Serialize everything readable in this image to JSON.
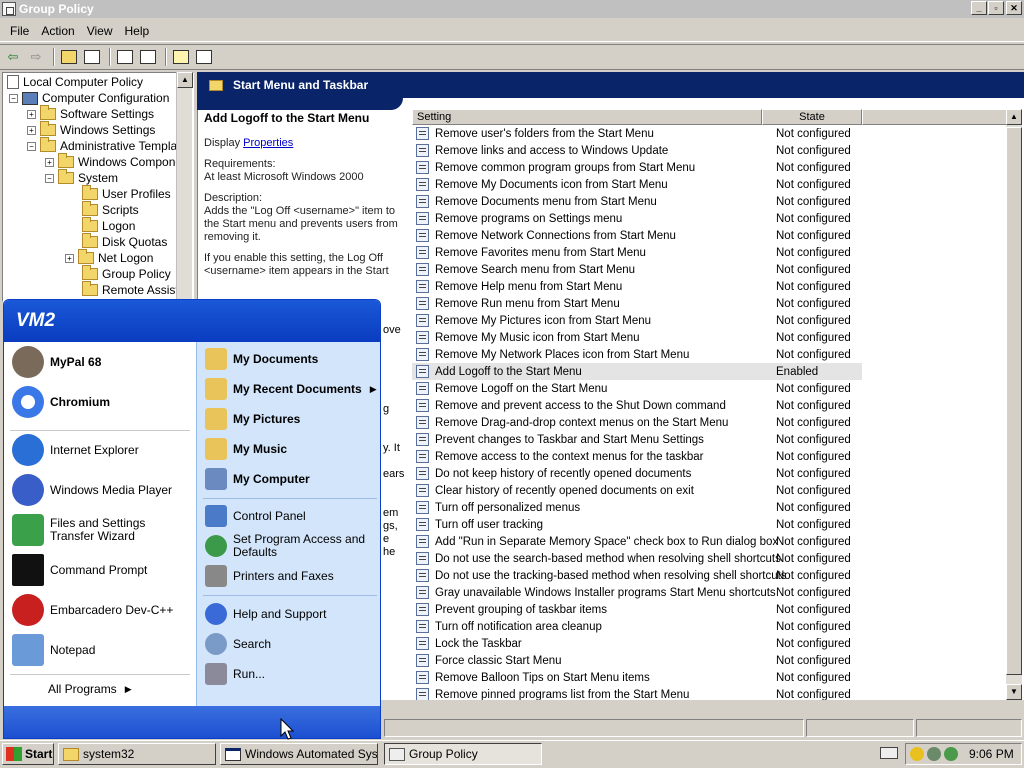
{
  "window": {
    "title": "Group Policy",
    "buttons": [
      "_",
      "▫",
      "✕"
    ]
  },
  "menubar": {
    "items": [
      "File",
      "Action",
      "View",
      "Help"
    ]
  },
  "toolbar": {
    "icons": [
      "back-icon",
      "forward-icon",
      "up-folder-icon",
      "show-hide-tree-icon",
      "properties-icon",
      "export-list-icon",
      "help-icon",
      "console-icon"
    ]
  },
  "tree": {
    "items": [
      {
        "label": "Local Computer Policy",
        "icon": "doc"
      },
      {
        "label": "Computer Configuration",
        "icon": "pc"
      },
      {
        "label": "Software Settings",
        "icon": "folder"
      },
      {
        "label": "Windows Settings",
        "icon": "folder"
      },
      {
        "label": "Administrative Template",
        "icon": "folder"
      },
      {
        "label": "Windows Compone",
        "icon": "folder"
      },
      {
        "label": "System",
        "icon": "folder"
      },
      {
        "label": "User Profiles",
        "icon": "folder"
      },
      {
        "label": "Scripts",
        "icon": "folder"
      },
      {
        "label": "Logon",
        "icon": "folder"
      },
      {
        "label": "Disk Quotas",
        "icon": "folder"
      },
      {
        "label": "Net Logon",
        "icon": "folder"
      },
      {
        "label": "Group Policy",
        "icon": "folder"
      },
      {
        "label": "Remote Assista",
        "icon": "folder"
      }
    ]
  },
  "pane": {
    "header": "Start Menu and Taskbar",
    "desc_title": "Add Logoff to the Start Menu",
    "display_label": "Display",
    "display_link": "Properties",
    "requirements_label": "Requirements:",
    "requirements_value": "At least Microsoft Windows 2000",
    "description_label": "Description:",
    "description_text": "Adds the \"Log Off <username>\" item to the Start menu and prevents users from removing it.",
    "description_more": "If you enable this setting, the Log Off <username> item appears in the Start",
    "peek": [
      "ove",
      "g",
      "y. It",
      "ears",
      "em",
      "gs,",
      "e",
      "he"
    ]
  },
  "list": {
    "columns": [
      "Setting",
      "State"
    ],
    "rows": [
      {
        "setting": "Remove user's folders from the Start Menu",
        "state": "Not configured"
      },
      {
        "setting": "Remove links and access to Windows Update",
        "state": "Not configured"
      },
      {
        "setting": "Remove common program groups from Start Menu",
        "state": "Not configured"
      },
      {
        "setting": "Remove My Documents icon from Start Menu",
        "state": "Not configured"
      },
      {
        "setting": "Remove Documents menu from Start Menu",
        "state": "Not configured"
      },
      {
        "setting": "Remove programs on Settings menu",
        "state": "Not configured"
      },
      {
        "setting": "Remove Network Connections from Start Menu",
        "state": "Not configured"
      },
      {
        "setting": "Remove Favorites menu from Start Menu",
        "state": "Not configured"
      },
      {
        "setting": "Remove Search menu from Start Menu",
        "state": "Not configured"
      },
      {
        "setting": "Remove Help menu from Start Menu",
        "state": "Not configured"
      },
      {
        "setting": "Remove Run menu from Start Menu",
        "state": "Not configured"
      },
      {
        "setting": "Remove My Pictures icon from Start Menu",
        "state": "Not configured"
      },
      {
        "setting": "Remove My Music icon from Start Menu",
        "state": "Not configured"
      },
      {
        "setting": "Remove My Network Places icon from Start Menu",
        "state": "Not configured"
      },
      {
        "setting": "Add Logoff to the Start Menu",
        "state": "Enabled",
        "selected": true
      },
      {
        "setting": "Remove Logoff on the Start Menu",
        "state": "Not configured"
      },
      {
        "setting": "Remove and prevent access to the Shut Down command",
        "state": "Not configured"
      },
      {
        "setting": "Remove Drag-and-drop context menus on the Start Menu",
        "state": "Not configured"
      },
      {
        "setting": "Prevent changes to Taskbar and Start Menu Settings",
        "state": "Not configured"
      },
      {
        "setting": "Remove access to the context menus for the taskbar",
        "state": "Not configured"
      },
      {
        "setting": "Do not keep history of recently opened documents",
        "state": "Not configured"
      },
      {
        "setting": "Clear history of recently opened documents on exit",
        "state": "Not configured"
      },
      {
        "setting": "Turn off personalized menus",
        "state": "Not configured"
      },
      {
        "setting": "Turn off user tracking",
        "state": "Not configured"
      },
      {
        "setting": "Add \"Run in Separate Memory Space\" check box to Run dialog box",
        "state": "Not configured"
      },
      {
        "setting": "Do not use the search-based method when resolving shell shortcuts",
        "state": "Not configured"
      },
      {
        "setting": "Do not use the tracking-based method when resolving shell shortcuts",
        "state": "Not configured"
      },
      {
        "setting": "Gray unavailable Windows Installer programs Start Menu shortcuts",
        "state": "Not configured"
      },
      {
        "setting": "Prevent grouping of taskbar items",
        "state": "Not configured"
      },
      {
        "setting": "Turn off notification area cleanup",
        "state": "Not configured"
      },
      {
        "setting": "Lock the Taskbar",
        "state": "Not configured"
      },
      {
        "setting": "Force classic Start Menu",
        "state": "Not configured"
      },
      {
        "setting": "Remove Balloon Tips on Start Menu items",
        "state": "Not configured"
      },
      {
        "setting": "Remove pinned programs list from the Start Menu",
        "state": "Not configured"
      }
    ]
  },
  "startmenu": {
    "user": "VM2",
    "pinned": [
      {
        "label": "MyPal 68",
        "color": "#7a6a5a"
      },
      {
        "label": "Chromium",
        "color": "#3b78e7"
      }
    ],
    "recent": [
      {
        "label": "Internet Explorer",
        "color": "#2a6fd6"
      },
      {
        "label": "Windows Media Player",
        "color": "#3a5ec8"
      },
      {
        "label": "Files and Settings Transfer Wizard",
        "color": "#3aa04a"
      },
      {
        "label": "Command Prompt",
        "color": "#111111"
      },
      {
        "label": "Embarcadero Dev-C++",
        "color": "#c8201e"
      },
      {
        "label": "Notepad",
        "color": "#6a9ad8"
      }
    ],
    "all_programs": "All Programs",
    "right_bold": [
      {
        "label": "My Documents",
        "color": "#e8c45a"
      },
      {
        "label": "My Recent Documents",
        "color": "#e8c45a",
        "arrow": true
      },
      {
        "label": "My Pictures",
        "color": "#e8c45a"
      },
      {
        "label": "My Music",
        "color": "#e8c45a"
      },
      {
        "label": "My Computer",
        "color": "#6a8ac0"
      }
    ],
    "right_mid": [
      {
        "label": "Control Panel",
        "color": "#4a7ac8"
      },
      {
        "label": "Set Program Access and Defaults",
        "color": "#3a9a4a"
      },
      {
        "label": "Printers and Faxes",
        "color": "#888888"
      }
    ],
    "right_bottom": [
      {
        "label": "Help and Support",
        "color": "#3a6ad8"
      },
      {
        "label": "Search",
        "color": "#7a9ac8"
      },
      {
        "label": "Run...",
        "color": "#8a8a9a"
      }
    ]
  },
  "taskbar": {
    "start": "Start",
    "tasks": [
      {
        "label": "system32",
        "pressed": false
      },
      {
        "label": "Windows Automated Syst...",
        "pressed": false
      },
      {
        "label": "Group Policy",
        "pressed": true
      }
    ],
    "time": "9:06 PM"
  }
}
